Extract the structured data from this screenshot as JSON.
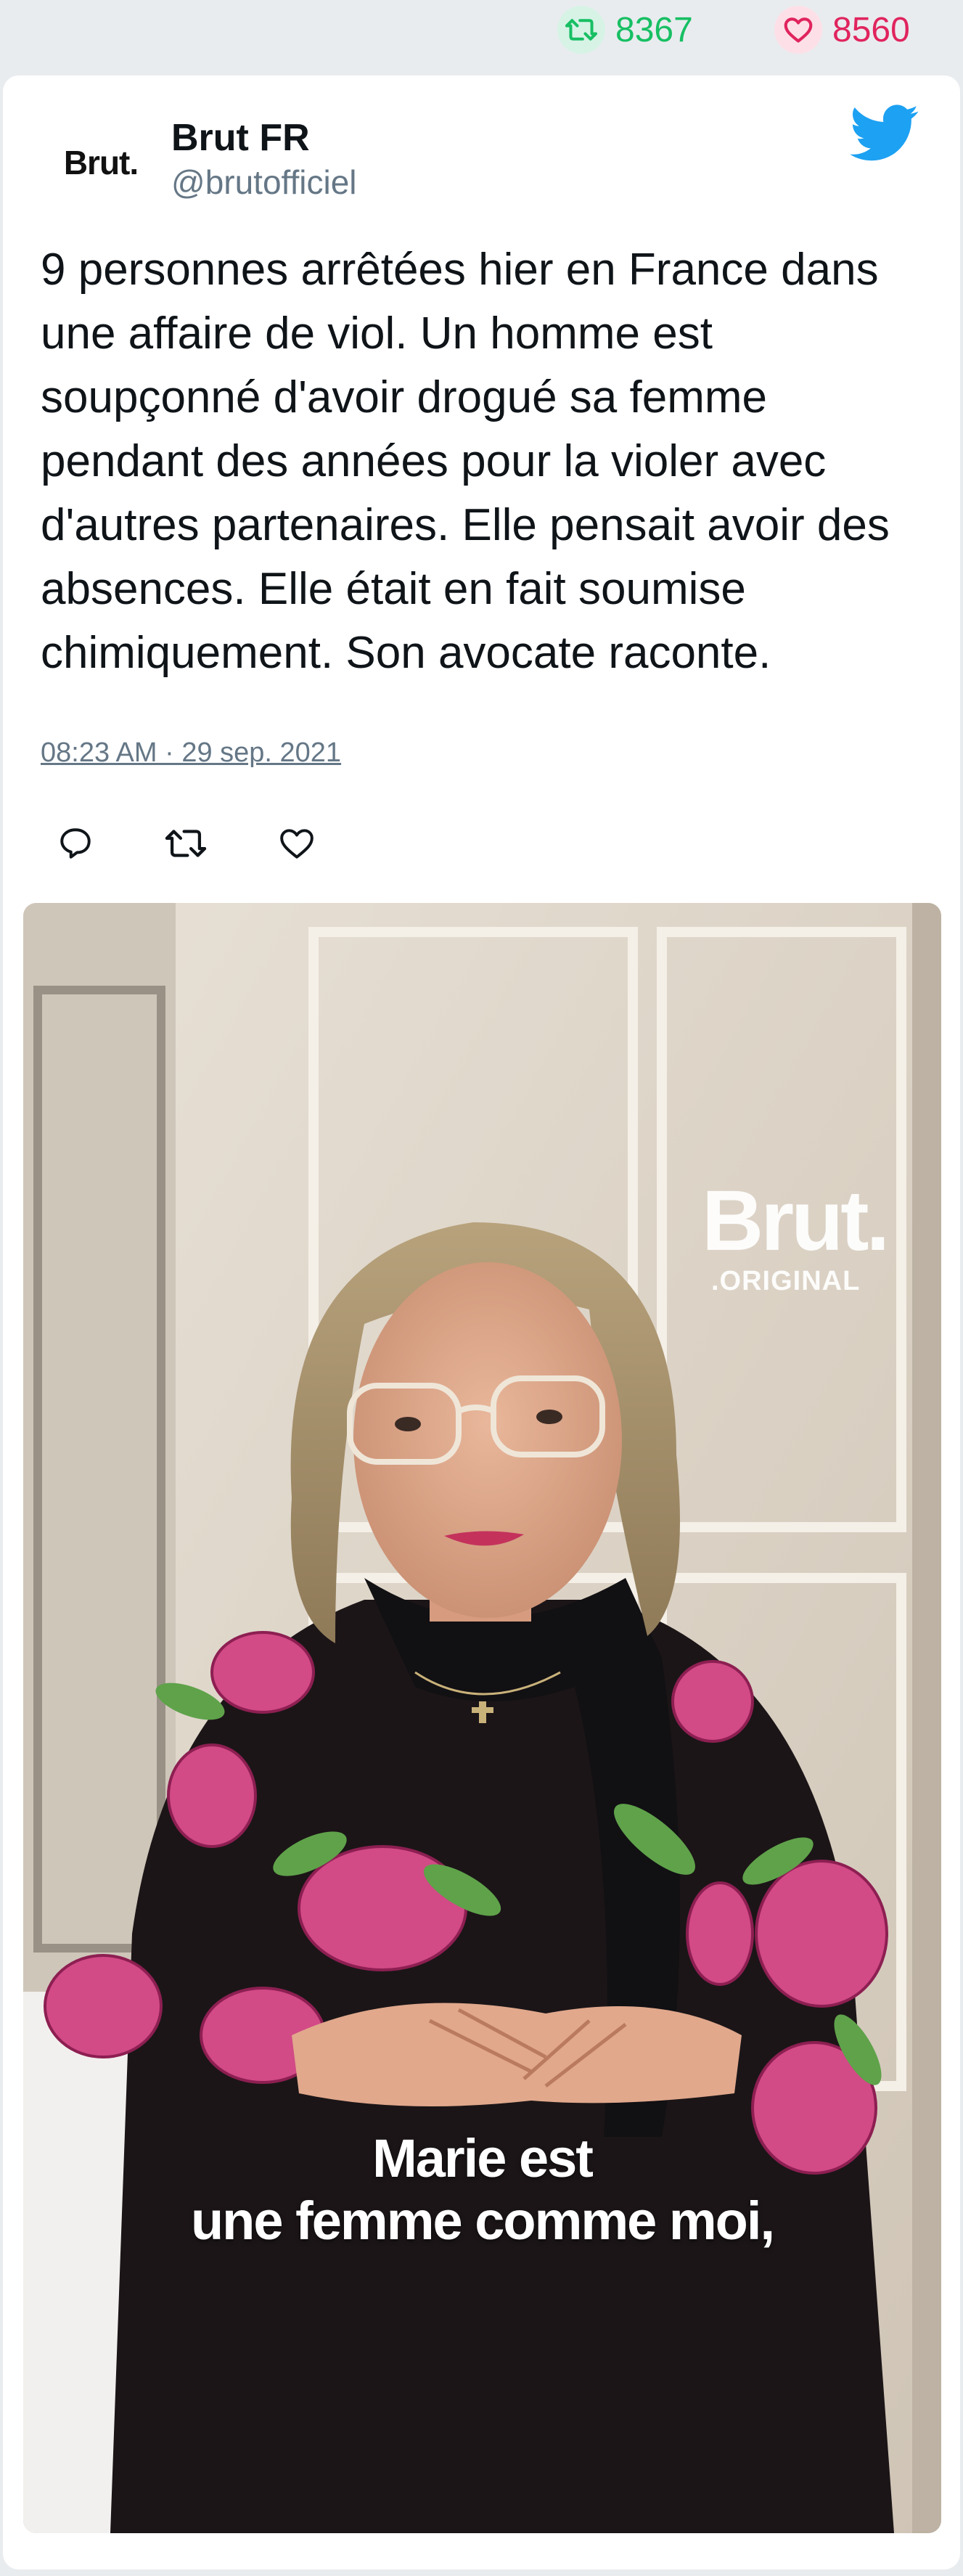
{
  "stats": {
    "retweets": "8367",
    "likes": "8560",
    "retweet_color": "#17bf63",
    "like_color": "#e0245e"
  },
  "author": {
    "avatar_text": "Brut.",
    "name": "Brut FR",
    "handle": "@brutofficiel"
  },
  "tweet": {
    "text": "9 personnes arrêtées hier en France dans une affaire de viol. Un homme est soupçonné d'avoir drogué sa femme pendant des années pour la violer avec d'autres partenaires. Elle pensait avoir des absences. Elle était en fait soumise chimiquement. Son avocate raconte.",
    "timestamp": "08:23 AM · 29 sep. 2021"
  },
  "actions": [
    {
      "icon": "reply-icon"
    },
    {
      "icon": "retweet-icon"
    },
    {
      "icon": "like-icon"
    }
  ],
  "media": {
    "watermark_brand": "Brut.",
    "watermark_sub": ".ORIGINAL",
    "caption_line1": "Marie est",
    "caption_line2": "une femme comme moi,"
  },
  "colors": {
    "twitter_blue": "#1da1f2",
    "text": "#0f1419",
    "secondary": "#657786"
  }
}
